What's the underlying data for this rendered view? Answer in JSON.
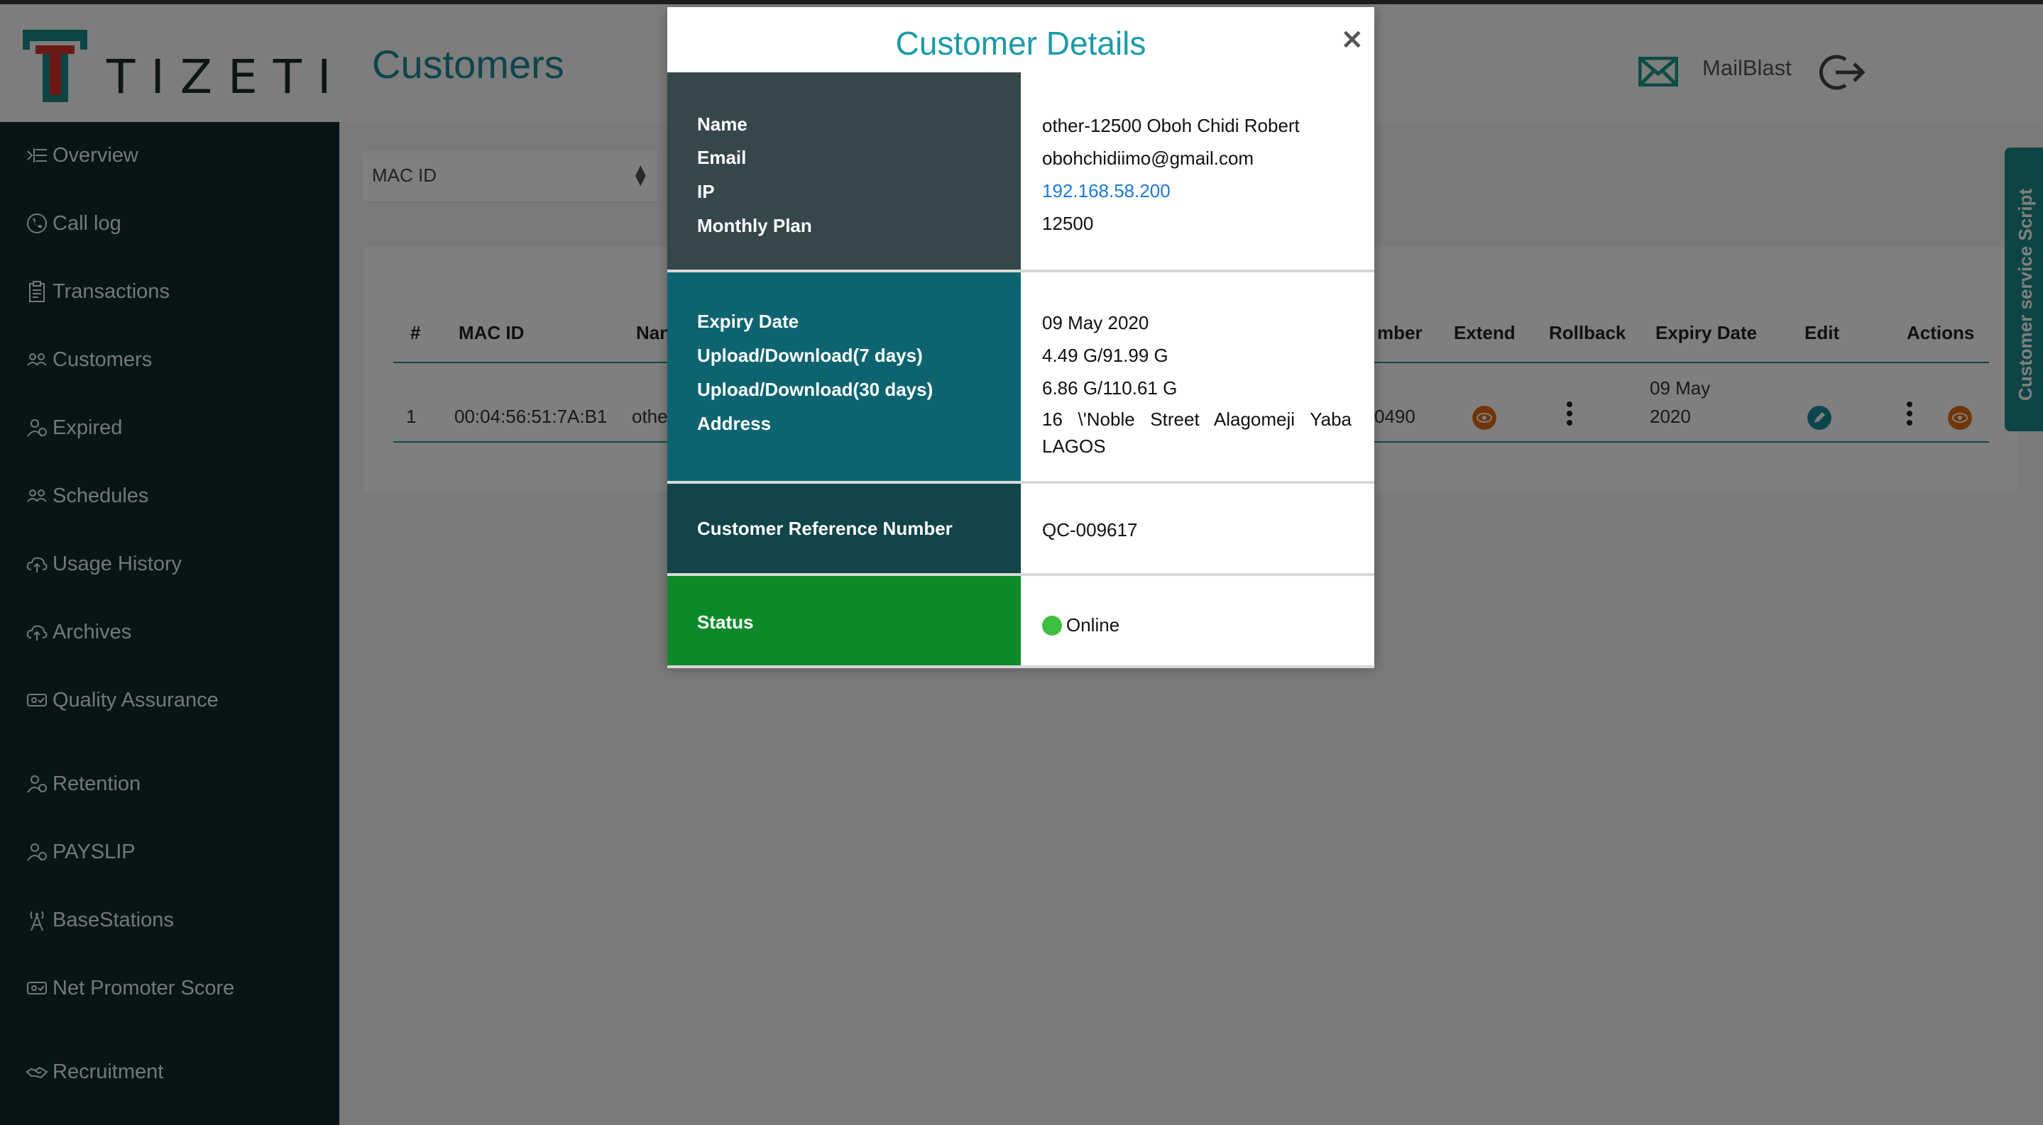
{
  "app": {
    "brand": "TIZETI",
    "page_title": "Customers",
    "mailblast_label": "MailBlast"
  },
  "sidebar": {
    "items": [
      {
        "label": "Overview",
        "icon": "list-indent-icon"
      },
      {
        "label": "Call log",
        "icon": "phone-icon"
      },
      {
        "label": "Transactions",
        "icon": "clipboard-icon"
      },
      {
        "label": "Customers",
        "icon": "users-icon"
      },
      {
        "label": "Expired",
        "icon": "user-clock-icon"
      },
      {
        "label": "Schedules",
        "icon": "users-icon"
      },
      {
        "label": "Usage History",
        "icon": "cloud-upload-icon"
      },
      {
        "label": "Archives",
        "icon": "cloud-upload-icon"
      },
      {
        "label": "Quality Assurance",
        "icon": "users-check-icon"
      },
      {
        "label": "Retention",
        "icon": "user-clock-icon"
      },
      {
        "label": "PAYSLIP",
        "icon": "user-clock-icon"
      },
      {
        "label": "BaseStations",
        "icon": "antenna-icon"
      },
      {
        "label": "Net Promoter Score",
        "icon": "users-check-icon"
      },
      {
        "label": "Recruitment",
        "icon": "handshake-icon"
      }
    ]
  },
  "filter": {
    "selected": "MAC ID"
  },
  "table": {
    "headers": {
      "num": "#",
      "mac": "MAC ID",
      "name": "Nan",
      "number": "mber",
      "extend": "Extend",
      "rollback": "Rollback",
      "expiry": "Expiry Date",
      "edit": "Edit",
      "actions": "Actions"
    },
    "row": {
      "num": "1",
      "mac": "00:04:56:51:7A:B1",
      "name": "othe",
      "number": "0490",
      "expiry_line1": "09 May",
      "expiry_line2": "2020"
    }
  },
  "side_tab": {
    "label": "Customer service Script"
  },
  "modal": {
    "title": "Customer Details",
    "close_symbol": "×",
    "labels": {
      "name": "Name",
      "email": "Email",
      "ip": "IP",
      "plan": "Monthly Plan",
      "expiry": "Expiry Date",
      "usage7": "Upload/Download(7 days)",
      "usage30": "Upload/Download(30 days)",
      "address": "Address",
      "ref": "Customer Reference Number",
      "status": "Status"
    },
    "values": {
      "name": "other-12500 Oboh Chidi Robert",
      "email": "obohchidiimo@gmail.com",
      "ip": "192.168.58.200",
      "plan": "12500",
      "expiry": "09 May 2020",
      "usage7": "4.49 G/91.99 G",
      "usage30": "6.86 G/110.61 G",
      "address": "16 \\'Noble Street Alagomeji Yaba LAGOS",
      "ref": "QC-009617",
      "status": "Online"
    }
  },
  "colors": {
    "sidebar_bg": "#102a2c",
    "accent_teal": "#1a8a96",
    "section_dark_slate": "#35474a",
    "section_teal": "#0d6470",
    "section_dark_teal": "#124448",
    "section_green": "#0c8a2a",
    "status_online": "#3cbf3c",
    "extend_orange": "#e06a10"
  }
}
